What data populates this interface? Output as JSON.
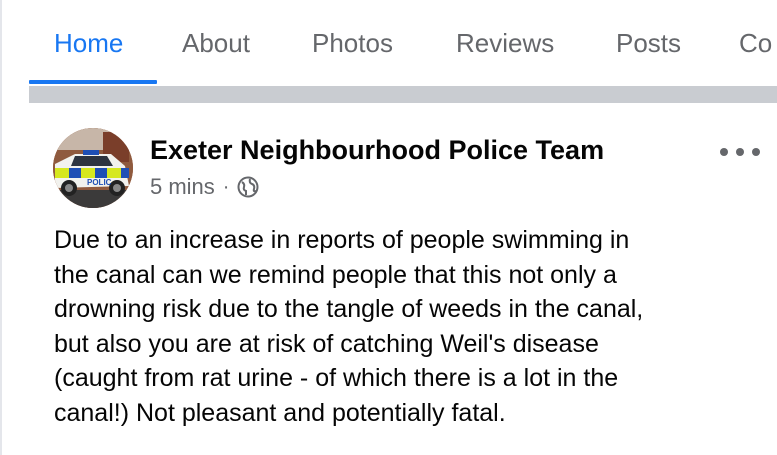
{
  "tabs": {
    "home": "Home",
    "about": "About",
    "photos": "Photos",
    "reviews": "Reviews",
    "posts": "Posts",
    "community": "Co"
  },
  "post": {
    "page_name": "Exeter Neighbourhood Police Team",
    "timestamp": "5 mins",
    "separator": "·",
    "privacy_icon": "globe-icon",
    "more_icon": "more-options-icon",
    "avatar_text": "POLIC",
    "text_lines": [
      "Due to an increase in reports of people swimming in",
      "the canal can we remind people that this not only a",
      "drowning risk due to the tangle of weeds in the canal,",
      "but also you are at risk of catching Weil's disease",
      "(caught from rat urine - of which there is a lot in the",
      "canal!) Not pleasant and potentially fatal."
    ]
  },
  "colors": {
    "accent": "#1877f2",
    "muted_text": "#65676b",
    "primary_text": "#050505",
    "divider": "#c9ccd1"
  }
}
